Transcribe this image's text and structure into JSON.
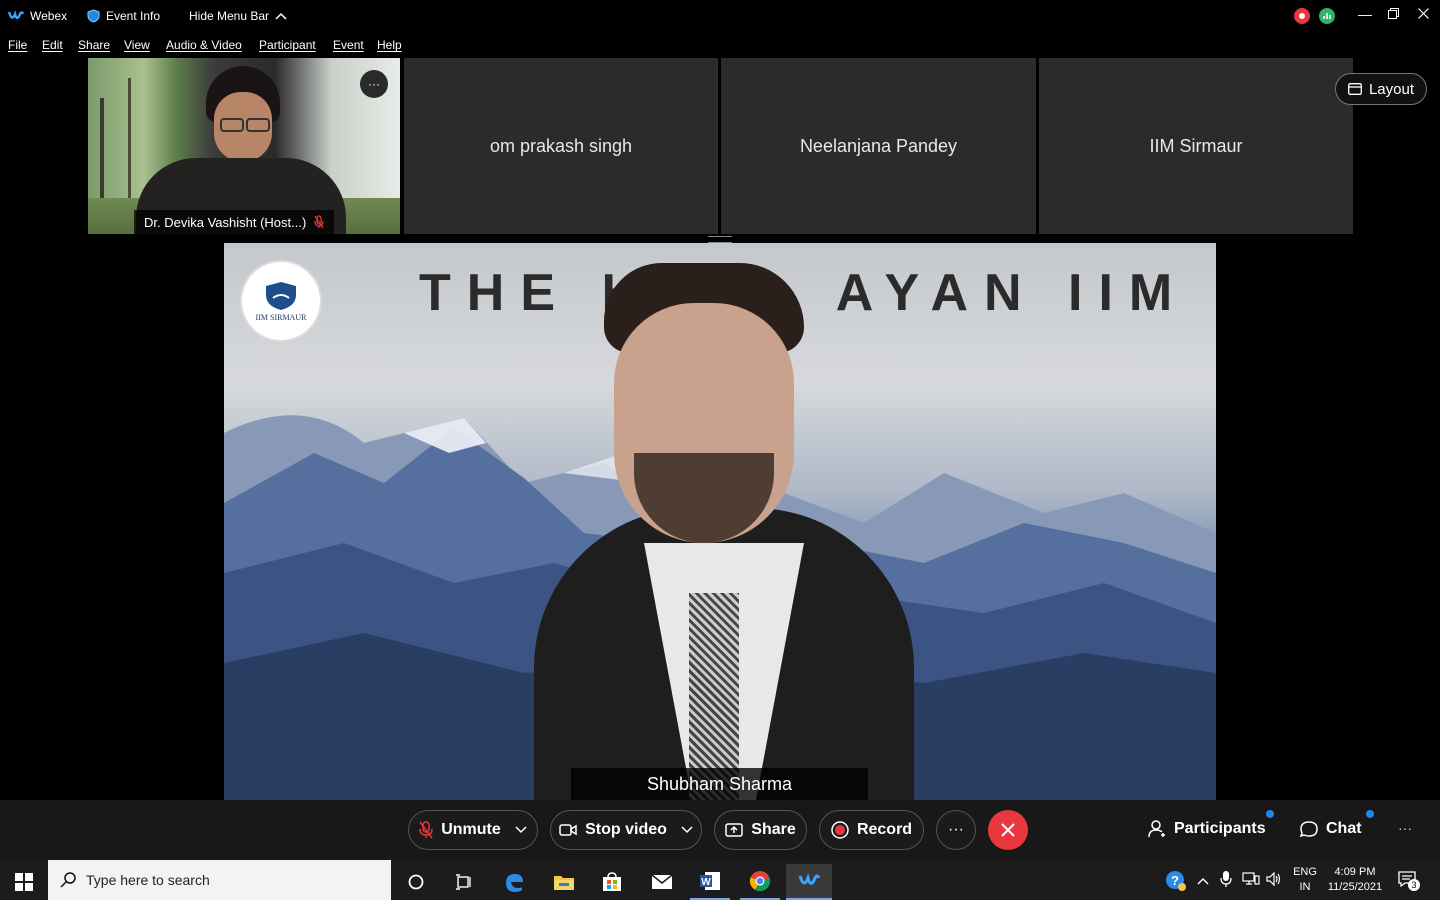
{
  "titlebar": {
    "app_name": "Webex",
    "event_info": "Event Info",
    "hide_menu": "Hide Menu Bar"
  },
  "menu": [
    "File",
    "Edit",
    "Share",
    "View",
    "Audio & Video",
    "Participant",
    "Event",
    "Help"
  ],
  "tiles": {
    "self_name": "Dr. Devika Vashisht  (Host...)",
    "others": [
      "om prakash singh",
      "Neelanjana Pandey",
      "IIM Sirmaur"
    ],
    "layout_label": "Layout"
  },
  "stage": {
    "banner": "THE HI     AYAN IIM",
    "logo_text": "IIM SIRMAUR",
    "speaker": "Shubham Sharma"
  },
  "controls": {
    "unmute": "Unmute",
    "stop_video": "Stop video",
    "share": "Share",
    "record": "Record",
    "more": "···",
    "participants": "Participants",
    "chat": "Chat"
  },
  "taskbar": {
    "search_placeholder": "Type here to search",
    "lang1": "ENG",
    "lang2": "IN",
    "time": "4:09 PM",
    "date": "11/25/2021",
    "notif_count": "3"
  },
  "colors": {
    "end_call": "#e8383d",
    "record_dot": "#e8383d",
    "accent": "#1e88e5"
  }
}
